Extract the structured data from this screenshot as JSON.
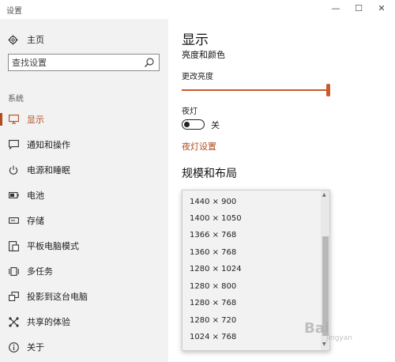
{
  "window": {
    "title": "设置",
    "minimize": "—",
    "maximize": "☐",
    "close": "✕"
  },
  "sidebar": {
    "home_label": "主页",
    "search_placeholder": "查找设置",
    "section_label": "系统",
    "items": [
      {
        "label": "显示",
        "icon": "monitor-icon",
        "active": true
      },
      {
        "label": "通知和操作",
        "icon": "message-icon",
        "active": false
      },
      {
        "label": "电源和睡眠",
        "icon": "power-icon",
        "active": false
      },
      {
        "label": "电池",
        "icon": "battery-icon",
        "active": false
      },
      {
        "label": "存储",
        "icon": "storage-icon",
        "active": false
      },
      {
        "label": "平板电脑模式",
        "icon": "tablet-icon",
        "active": false
      },
      {
        "label": "多任务",
        "icon": "multitask-icon",
        "active": false
      },
      {
        "label": "投影到这台电脑",
        "icon": "project-icon",
        "active": false
      },
      {
        "label": "共享的体验",
        "icon": "share-icon",
        "active": false
      },
      {
        "label": "关于",
        "icon": "info-icon",
        "active": false
      }
    ]
  },
  "main": {
    "title": "显示",
    "brightness_section": "亮度和颜色",
    "brightness_label": "更改亮度",
    "brightness_value": 1.0,
    "night_light_label": "夜灯",
    "night_light_state": "关",
    "night_light_settings_link": "夜灯设置",
    "scale_section": "规模和布局",
    "resolution_options": [
      "1440 × 900",
      "1400 × 1050",
      "1366 × 768",
      "1360 × 768",
      "1280 × 1024",
      "1280 × 800",
      "1280 × 768",
      "1280 × 720",
      "1024 × 768"
    ]
  },
  "watermark": {
    "text": "Bai",
    "sub": "jingyan"
  },
  "colors": {
    "accent": "#b44b1e",
    "sidebar_bg": "#f2f2f2"
  }
}
